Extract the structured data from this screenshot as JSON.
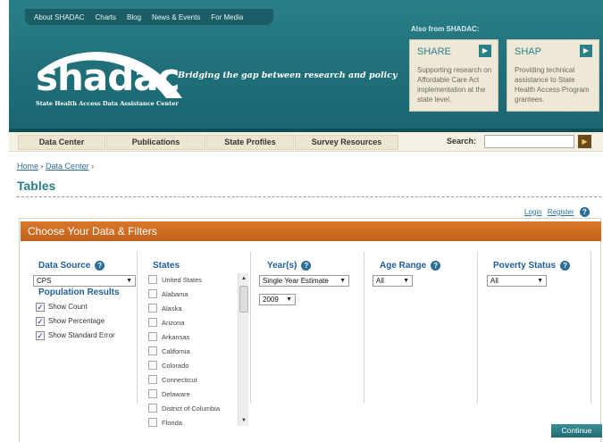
{
  "top_nav": [
    "About SHADAC",
    "Charts",
    "Blog",
    "News & Events",
    "For Media"
  ],
  "logo": {
    "text": "shadac",
    "subtitle": "State Health Access Data Assistance Center"
  },
  "tagline": "Bridging the gap between research and policy",
  "also_from": {
    "label": "Also from SHADAC:",
    "cards": [
      {
        "title": "SHARE",
        "text": "Supporting research on Affordable Care Act implementation at the state level."
      },
      {
        "title": "SHAP",
        "text": "Providing technical assistance to State Health Access Program grantees."
      }
    ]
  },
  "main_nav": [
    "Data Center",
    "Publications",
    "State Profiles",
    "Survey Resources"
  ],
  "search": {
    "label": "Search:",
    "value": ""
  },
  "breadcrumb": {
    "home": "Home",
    "sep": "›",
    "data_center": "Data Center"
  },
  "page_title": "Tables",
  "auth": {
    "login": "Login",
    "register": "Register"
  },
  "panel_title": "Choose Your Data & Filters",
  "filters": {
    "data_source": {
      "title": "Data Source",
      "value": "CPS"
    },
    "population_results": {
      "title": "Population Results",
      "options": [
        {
          "label": "Show Count",
          "checked": true
        },
        {
          "label": "Show Percentage",
          "checked": true
        },
        {
          "label": "Show Standard Error",
          "checked": true
        }
      ]
    },
    "states": {
      "title": "States",
      "items": [
        "United States",
        "Alabama",
        "Alaska",
        "Arizona",
        "Arkansas",
        "California",
        "Colorado",
        "Connecticut",
        "Delaware",
        "District of Columbia",
        "Florida"
      ]
    },
    "years": {
      "title": "Year(s)",
      "estimate": "Single Year Estimate",
      "year": "2009"
    },
    "age_range": {
      "title": "Age Range",
      "value": "All"
    },
    "poverty_status": {
      "title": "Poverty Status",
      "value": "All"
    }
  },
  "continue_label": "Continue"
}
